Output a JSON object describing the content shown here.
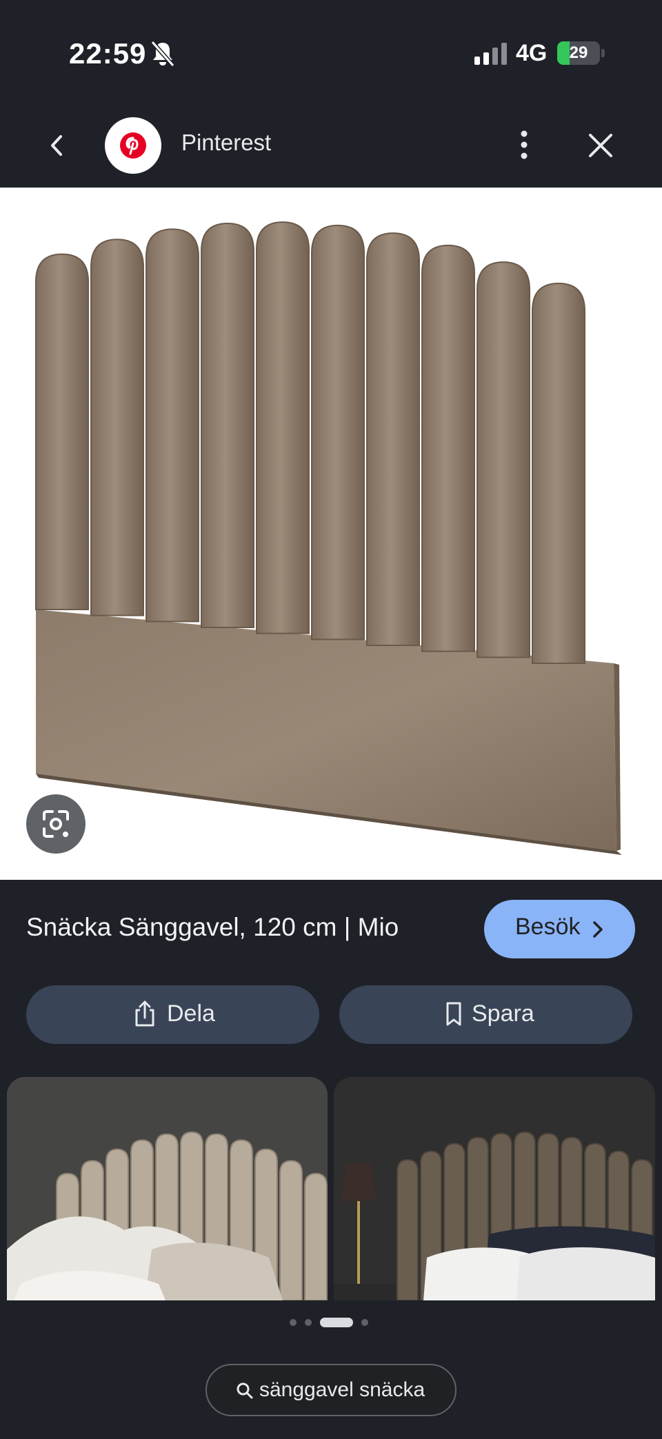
{
  "status_bar": {
    "time": "22:59",
    "network": "4G",
    "battery_level": "29",
    "battery_charging": true,
    "battery_fill": 0.29,
    "colors": {
      "battery": "#34c759"
    }
  },
  "header": {
    "site_name": "Pinterest",
    "site_icon": "pinterest-logo",
    "colors": {
      "brand": "#e60023"
    }
  },
  "result": {
    "title": "Snäcka Sänggavel, 120 cm | Mio",
    "visit_label": "Besök",
    "share_label": "Dela",
    "save_label": "Spara",
    "colors": {
      "visit_button": "#8ab4f8",
      "pill_button": "#394457"
    }
  },
  "pagination": {
    "count": 4,
    "active_index": 2
  },
  "related_search": {
    "label": "sänggavel snäcka",
    "icon": "search-icon"
  }
}
